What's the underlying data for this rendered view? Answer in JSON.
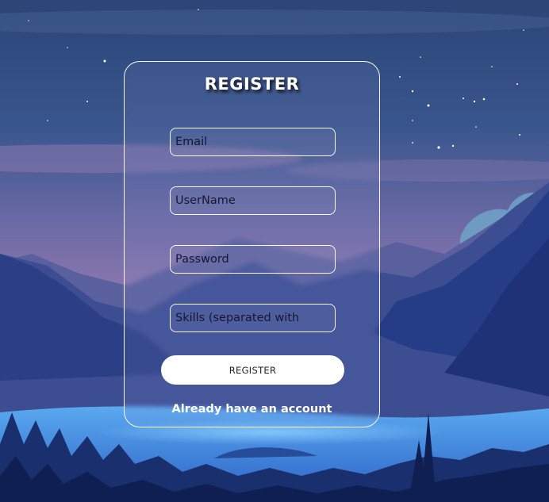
{
  "form": {
    "title": "REGISTER",
    "email_placeholder": "Email",
    "username_placeholder": "UserName",
    "password_placeholder": "Password",
    "skills_placeholder": "Skills (separated with",
    "submit_label": "REGISTER",
    "login_link": "Already have an account"
  },
  "colors": {
    "sky_top": "#2b4a80",
    "sky_mid": "#7c6fa8",
    "mountain_dark": "#1c2a66",
    "lake": "#4d9bea",
    "accent_white": "#ffffff"
  }
}
